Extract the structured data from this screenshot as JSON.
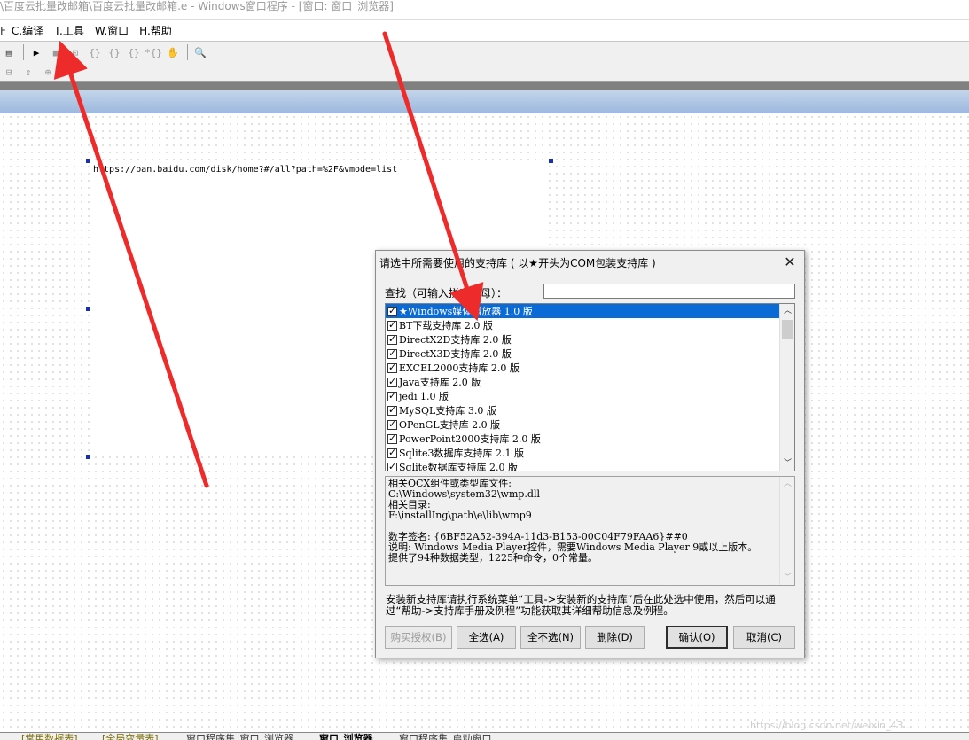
{
  "window": {
    "title": "\\百度云批量改邮箱\\百度云批量改邮箱.e - Windows窗口程序 - [窗口: 窗口_浏览器]"
  },
  "menubar": {
    "items": [
      {
        "key": "C",
        "label": "C.编译"
      },
      {
        "key": "T",
        "label": "T.工具"
      },
      {
        "key": "W",
        "label": "W.窗口"
      },
      {
        "key": "H",
        "label": "H.帮助"
      }
    ]
  },
  "toolbar": {
    "row1": [
      "form-icon",
      "run-icon",
      "stop-icon",
      "step-icon",
      "step-into-icon",
      "step-over-icon",
      "step-out-icon",
      "run-to-icon",
      "hand-icon",
      "search-lib-icon"
    ],
    "row2": [
      "align-icon",
      "resize-v-icon",
      "center-icon"
    ]
  },
  "designer": {
    "url_text": "https://pan.baidu.com/disk/home?#/all?path=%2F&vmode=list"
  },
  "dialog": {
    "title": "请选中所需要使用的支持库 ( 以★开头为COM包装支持库 )",
    "close_glyph": "✕",
    "search_label": "查找（可输入拼音字母）：",
    "search_value": "",
    "libraries": [
      {
        "label": "★Windows媒体播放器 1.0 版",
        "checked": true,
        "selected": true
      },
      {
        "label": "BT下载支持库 2.0 版",
        "checked": true,
        "selected": false
      },
      {
        "label": "DirectX2D支持库 2.0 版",
        "checked": true,
        "selected": false
      },
      {
        "label": "DirectX3D支持库 2.0 版",
        "checked": true,
        "selected": false
      },
      {
        "label": "EXCEL2000支持库 2.0 版",
        "checked": true,
        "selected": false
      },
      {
        "label": "Java支持库 2.0 版",
        "checked": true,
        "selected": false
      },
      {
        "label": "jedi 1.0 版",
        "checked": true,
        "selected": false
      },
      {
        "label": "MySQL支持库 3.0 版",
        "checked": true,
        "selected": false
      },
      {
        "label": "OPenGL支持库 2.0 版",
        "checked": true,
        "selected": false
      },
      {
        "label": "PowerPoint2000支持库 2.0 版",
        "checked": true,
        "selected": false
      },
      {
        "label": "Sqlite3数据库支持库 2.1 版",
        "checked": true,
        "selected": false
      },
      {
        "label": "Sqlite数据库支持库 2.0 版",
        "checked": true,
        "selected": false
      }
    ],
    "info_lines": [
      "相关OCX组件或类型库文件:",
      "C:\\Windows\\system32\\wmp.dll",
      "相关目录:",
      "F:\\installIng\\path\\e\\lib\\wmp9",
      "",
      "数字签名: {6BF52A52-394A-11d3-B153-00C04F79FAA6}##0",
      "说明:  Windows Media Player控件，需要Windows Media Player 9或以上版本。",
      "提供了94种数据类型，1225种命令，0个常量。"
    ],
    "notes": "安装新支持库请执行系统菜单“工具->安装新的支持库”后在此处选中使用，然后可以通过“帮助->支持库手册及例程”功能获取其详细帮助信息及例程。",
    "buttons": {
      "buy": "购买授权(B)",
      "select_all": "全选(A)",
      "select_none": "全不选(N)",
      "delete": "删除(D)",
      "ok": "确认(O)",
      "cancel": "取消(C)"
    }
  },
  "bottom_tabs": [
    {
      "label": "[常用数据表]",
      "style": "y"
    },
    {
      "label": "[全局变量表]",
      "style": "y"
    },
    {
      "label": "窗口程序集_窗口_浏览器",
      "style": "n"
    },
    {
      "label": "窗口_浏览器",
      "style": "b"
    },
    {
      "label": "窗口程序集_启动窗口",
      "style": "n"
    }
  ],
  "watermark": "https://blog.csdn.net/weixin_43..."
}
